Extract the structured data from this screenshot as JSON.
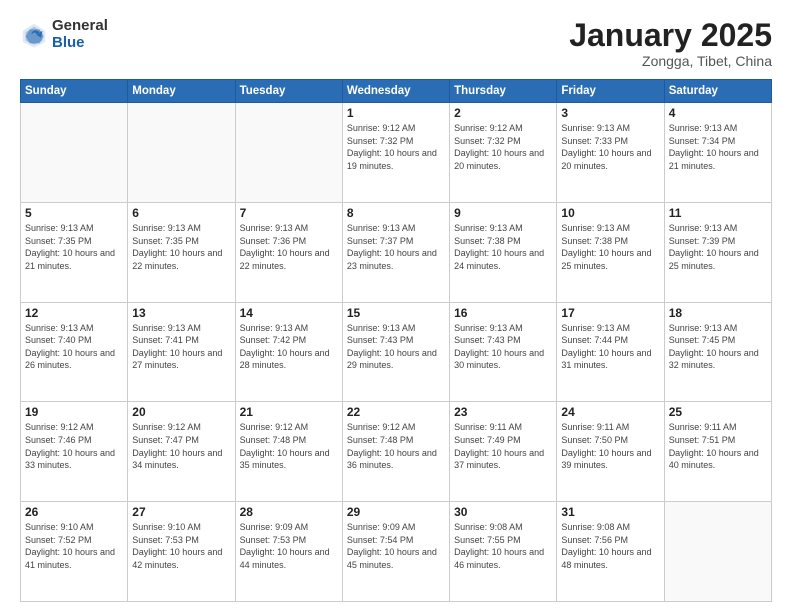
{
  "header": {
    "logo_general": "General",
    "logo_blue": "Blue",
    "month_title": "January 2025",
    "subtitle": "Zongga, Tibet, China"
  },
  "days_of_week": [
    "Sunday",
    "Monday",
    "Tuesday",
    "Wednesday",
    "Thursday",
    "Friday",
    "Saturday"
  ],
  "weeks": [
    [
      {
        "day": "",
        "detail": ""
      },
      {
        "day": "",
        "detail": ""
      },
      {
        "day": "",
        "detail": ""
      },
      {
        "day": "1",
        "detail": "Sunrise: 9:12 AM\nSunset: 7:32 PM\nDaylight: 10 hours and 19 minutes."
      },
      {
        "day": "2",
        "detail": "Sunrise: 9:12 AM\nSunset: 7:32 PM\nDaylight: 10 hours and 20 minutes."
      },
      {
        "day": "3",
        "detail": "Sunrise: 9:13 AM\nSunset: 7:33 PM\nDaylight: 10 hours and 20 minutes."
      },
      {
        "day": "4",
        "detail": "Sunrise: 9:13 AM\nSunset: 7:34 PM\nDaylight: 10 hours and 21 minutes."
      }
    ],
    [
      {
        "day": "5",
        "detail": "Sunrise: 9:13 AM\nSunset: 7:35 PM\nDaylight: 10 hours and 21 minutes."
      },
      {
        "day": "6",
        "detail": "Sunrise: 9:13 AM\nSunset: 7:35 PM\nDaylight: 10 hours and 22 minutes."
      },
      {
        "day": "7",
        "detail": "Sunrise: 9:13 AM\nSunset: 7:36 PM\nDaylight: 10 hours and 22 minutes."
      },
      {
        "day": "8",
        "detail": "Sunrise: 9:13 AM\nSunset: 7:37 PM\nDaylight: 10 hours and 23 minutes."
      },
      {
        "day": "9",
        "detail": "Sunrise: 9:13 AM\nSunset: 7:38 PM\nDaylight: 10 hours and 24 minutes."
      },
      {
        "day": "10",
        "detail": "Sunrise: 9:13 AM\nSunset: 7:38 PM\nDaylight: 10 hours and 25 minutes."
      },
      {
        "day": "11",
        "detail": "Sunrise: 9:13 AM\nSunset: 7:39 PM\nDaylight: 10 hours and 25 minutes."
      }
    ],
    [
      {
        "day": "12",
        "detail": "Sunrise: 9:13 AM\nSunset: 7:40 PM\nDaylight: 10 hours and 26 minutes."
      },
      {
        "day": "13",
        "detail": "Sunrise: 9:13 AM\nSunset: 7:41 PM\nDaylight: 10 hours and 27 minutes."
      },
      {
        "day": "14",
        "detail": "Sunrise: 9:13 AM\nSunset: 7:42 PM\nDaylight: 10 hours and 28 minutes."
      },
      {
        "day": "15",
        "detail": "Sunrise: 9:13 AM\nSunset: 7:43 PM\nDaylight: 10 hours and 29 minutes."
      },
      {
        "day": "16",
        "detail": "Sunrise: 9:13 AM\nSunset: 7:43 PM\nDaylight: 10 hours and 30 minutes."
      },
      {
        "day": "17",
        "detail": "Sunrise: 9:13 AM\nSunset: 7:44 PM\nDaylight: 10 hours and 31 minutes."
      },
      {
        "day": "18",
        "detail": "Sunrise: 9:13 AM\nSunset: 7:45 PM\nDaylight: 10 hours and 32 minutes."
      }
    ],
    [
      {
        "day": "19",
        "detail": "Sunrise: 9:12 AM\nSunset: 7:46 PM\nDaylight: 10 hours and 33 minutes."
      },
      {
        "day": "20",
        "detail": "Sunrise: 9:12 AM\nSunset: 7:47 PM\nDaylight: 10 hours and 34 minutes."
      },
      {
        "day": "21",
        "detail": "Sunrise: 9:12 AM\nSunset: 7:48 PM\nDaylight: 10 hours and 35 minutes."
      },
      {
        "day": "22",
        "detail": "Sunrise: 9:12 AM\nSunset: 7:48 PM\nDaylight: 10 hours and 36 minutes."
      },
      {
        "day": "23",
        "detail": "Sunrise: 9:11 AM\nSunset: 7:49 PM\nDaylight: 10 hours and 37 minutes."
      },
      {
        "day": "24",
        "detail": "Sunrise: 9:11 AM\nSunset: 7:50 PM\nDaylight: 10 hours and 39 minutes."
      },
      {
        "day": "25",
        "detail": "Sunrise: 9:11 AM\nSunset: 7:51 PM\nDaylight: 10 hours and 40 minutes."
      }
    ],
    [
      {
        "day": "26",
        "detail": "Sunrise: 9:10 AM\nSunset: 7:52 PM\nDaylight: 10 hours and 41 minutes."
      },
      {
        "day": "27",
        "detail": "Sunrise: 9:10 AM\nSunset: 7:53 PM\nDaylight: 10 hours and 42 minutes."
      },
      {
        "day": "28",
        "detail": "Sunrise: 9:09 AM\nSunset: 7:53 PM\nDaylight: 10 hours and 44 minutes."
      },
      {
        "day": "29",
        "detail": "Sunrise: 9:09 AM\nSunset: 7:54 PM\nDaylight: 10 hours and 45 minutes."
      },
      {
        "day": "30",
        "detail": "Sunrise: 9:08 AM\nSunset: 7:55 PM\nDaylight: 10 hours and 46 minutes."
      },
      {
        "day": "31",
        "detail": "Sunrise: 9:08 AM\nSunset: 7:56 PM\nDaylight: 10 hours and 48 minutes."
      },
      {
        "day": "",
        "detail": ""
      }
    ]
  ]
}
